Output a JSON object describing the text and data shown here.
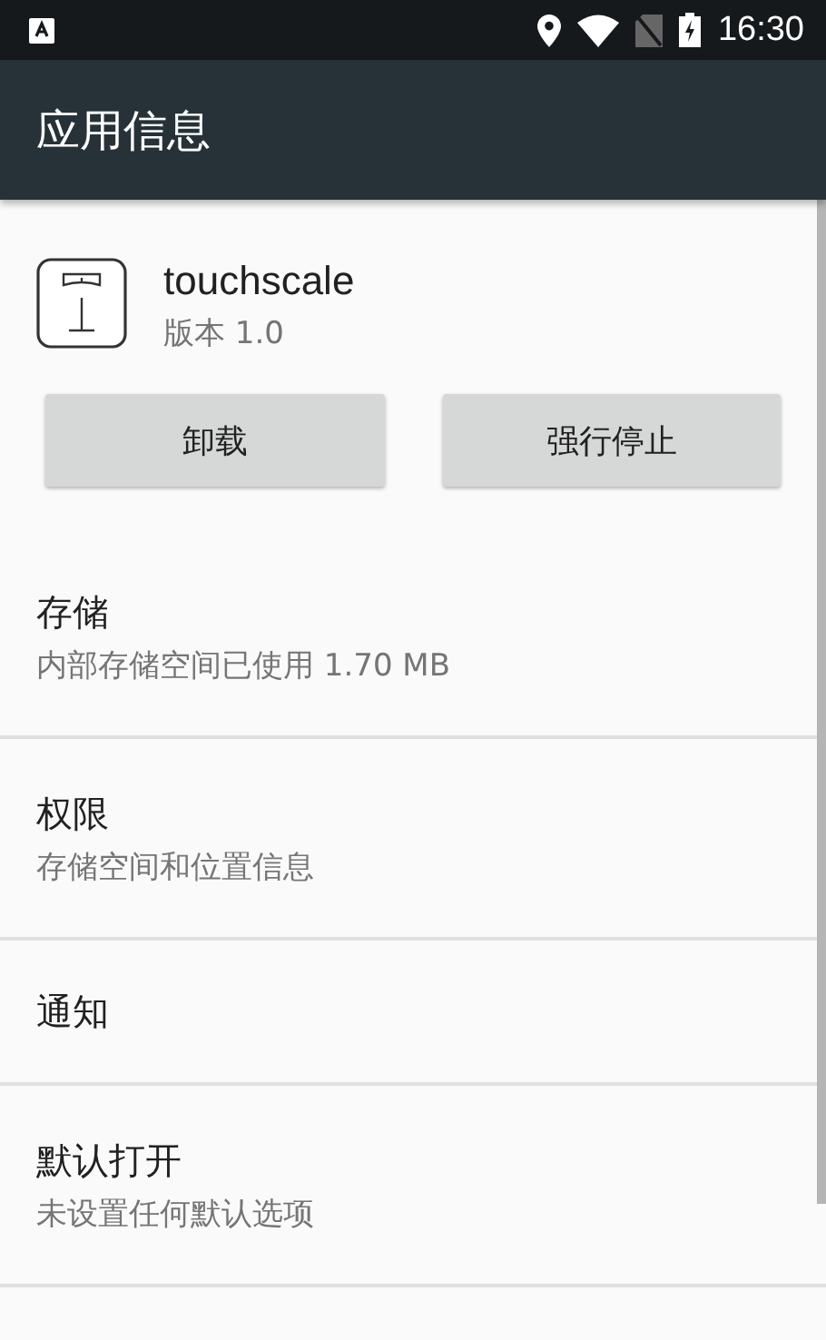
{
  "status_bar": {
    "time": "16:30"
  },
  "toolbar": {
    "title": "应用信息"
  },
  "app": {
    "name": "touchscale",
    "version": "版本 1.0"
  },
  "buttons": [
    "卸载",
    "强行停止"
  ],
  "sections": [
    {
      "title": "存储",
      "summary": "内部存储空间已使用 1.70 MB"
    },
    {
      "title": "权限",
      "summary": "存储空间和位置信息"
    },
    {
      "title": "通知"
    },
    {
      "title": "默认打开",
      "summary": "未设置任何默认选项"
    }
  ]
}
